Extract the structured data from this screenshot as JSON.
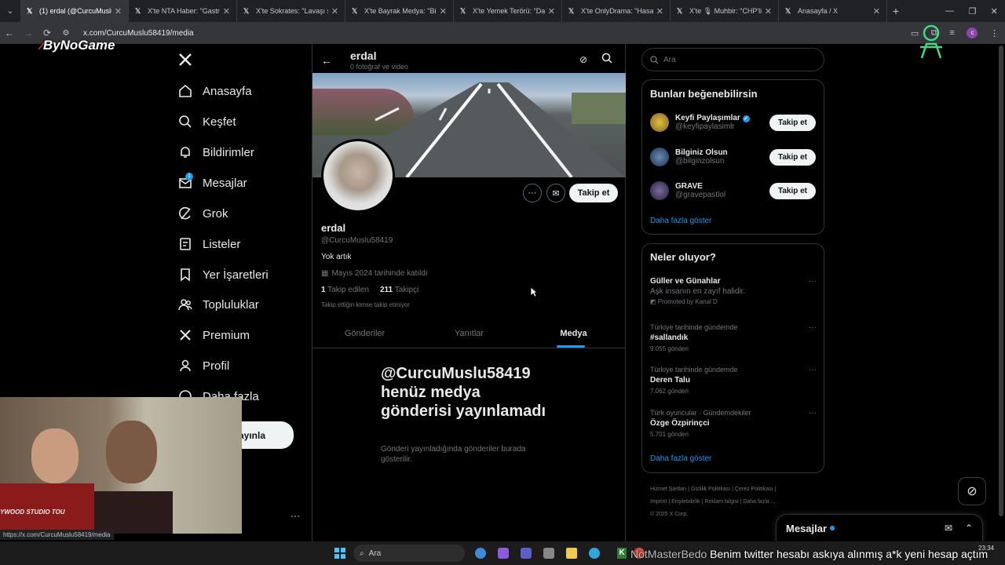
{
  "browser": {
    "tabs": [
      {
        "label": "(1) erdal (@CurcuMuslu58419",
        "active": true
      },
      {
        "label": "X'te NTA Haber: \"Gastron",
        "active": false
      },
      {
        "label": "X'te Sokrates: \"Lavaşı sos",
        "active": false
      },
      {
        "label": "X'te Bayrak Medya: \"Bir ac",
        "active": false
      },
      {
        "label": "X'te Yemek Terörü: \"Dam",
        "active": false
      },
      {
        "label": "X'te OnlyDrama: \"HasanA",
        "active": false
      },
      {
        "label": "X'te 🎙 Muhbir: \"CHP'li V",
        "active": false
      },
      {
        "label": "Anasayfa / X",
        "active": false
      }
    ],
    "url": "x.com/CurcuMuslu58419/media",
    "status_url": "https://x.com/CurcuMuslu58419/media"
  },
  "overlay": {
    "logo": "ByNoGame",
    "ticker_user": "NotMasterBedo",
    "ticker_text": "Benim twitter hesabı askıya alınmış a*k yeni hesap açtım",
    "webcam_text": "YWOOD STUDIO TOU"
  },
  "nav": {
    "items": [
      {
        "label": "Anasayfa",
        "icon": "home-icon"
      },
      {
        "label": "Keşfet",
        "icon": "search-icon"
      },
      {
        "label": "Bildirimler",
        "icon": "bell-icon"
      },
      {
        "label": "Mesajlar",
        "icon": "mail-icon"
      },
      {
        "label": "Grok",
        "icon": "grok-icon"
      },
      {
        "label": "Listeler",
        "icon": "list-icon"
      },
      {
        "label": "Yer İşaretleri",
        "icon": "bookmark-icon"
      },
      {
        "label": "Topluluklar",
        "icon": "community-icon"
      },
      {
        "label": "Premium",
        "icon": "x-icon"
      },
      {
        "label": "Profil",
        "icon": "person-icon"
      },
      {
        "label": "Daha fazla",
        "icon": "more-icon"
      }
    ],
    "post_button": "ayınla",
    "messages_badge": "1"
  },
  "header": {
    "name": "erdal",
    "subtitle": "0 fotoğraf ve video"
  },
  "profile": {
    "name": "erdal",
    "handle": "@CurcuMuslu58419",
    "bio": "Yok artık",
    "joined": "Mayıs 2024 tarihinde katıldı",
    "following_count": "1",
    "following_label": "Takip edilen",
    "followers_count": "211",
    "followers_label": "Takipçi",
    "followed_by": "Takip ettiğin kimse takip etmiyor",
    "follow_button": "Takip et"
  },
  "tabs": [
    {
      "label": "Gönderiler",
      "active": false
    },
    {
      "label": "Yanıtlar",
      "active": false
    },
    {
      "label": "Medya",
      "active": true
    }
  ],
  "empty": {
    "title": "@CurcuMuslu58419 henüz medya gönderisi yayınlamadı",
    "body": "Gönderi yayınladığında gönderiler burada gösterilir."
  },
  "search": {
    "placeholder": "Ara"
  },
  "who_to_follow": {
    "title": "Bunları beğenebilirsin",
    "users": [
      {
        "name": "Keyfi Paylaşımlar",
        "handle": "@keyfipaylasimlr",
        "verified": true,
        "button": "Takip et"
      },
      {
        "name": "Bilginiz Olsun",
        "handle": "@bilginzolsun",
        "verified": false,
        "button": "Takip et"
      },
      {
        "name": "GRAVE",
        "handle": "@gravepastlol",
        "verified": false,
        "button": "Takip et"
      }
    ],
    "more": "Daha fazla göster"
  },
  "trends": {
    "title": "Neler oluyor?",
    "items": [
      {
        "context": "",
        "name": "Güller ve Günahlar",
        "sub": "Aşk insanın en zayıf halidir.",
        "meta": "Promoted by Kanal D"
      },
      {
        "context": "Türkiye tarihinde gündemde",
        "name": "#sallandık",
        "sub": "",
        "meta": "9.055 gönderi"
      },
      {
        "context": "Türkiye tarihinde gündemde",
        "name": "Deren Talu",
        "sub": "",
        "meta": "7.062 gönderi"
      },
      {
        "context": "Türk oyuncular · Gündemdekiler",
        "name": "Özge Özpirinçci",
        "sub": "",
        "meta": "5.701 gönderi"
      }
    ],
    "more": "Daha fazla göster"
  },
  "footer": {
    "links": [
      "Hizmet Şartları",
      "Gizlilik Politikası",
      "Çerez Politikası",
      "Imprint",
      "Erişilebilirlik",
      "Reklam bilgisi",
      "Daha fazla ..."
    ],
    "copyright": "© 2025 X Corp."
  },
  "messages_drawer": {
    "label": "Mesajlar"
  },
  "taskbar": {
    "search": "Ara",
    "time": "23:34"
  }
}
